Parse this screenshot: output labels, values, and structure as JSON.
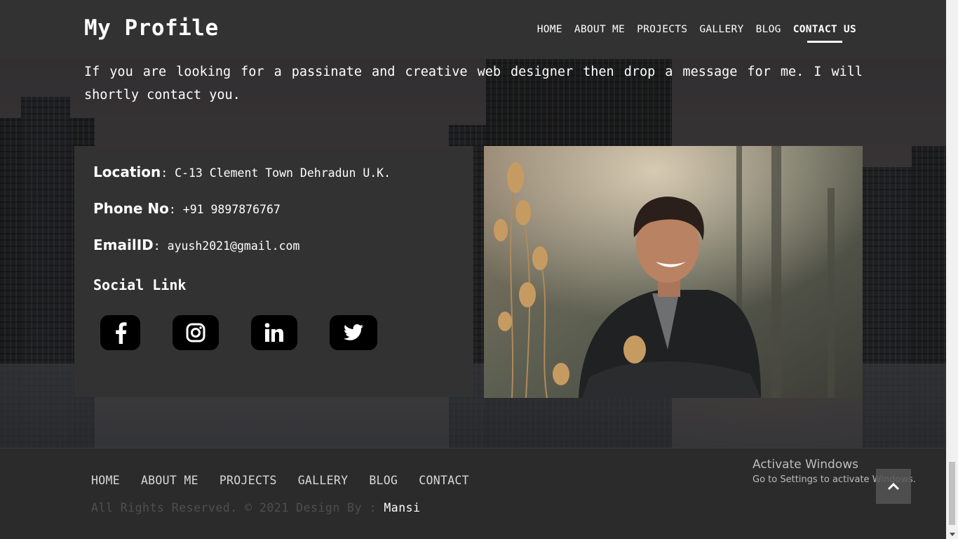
{
  "header": {
    "brand": "My Profile",
    "nav": [
      "HOME",
      "ABOUT ME",
      "PROJECTS",
      "GALLERY",
      "BLOG",
      "CONTACT US"
    ],
    "active_nav": "CONTACT US"
  },
  "intro": "If you are looking for a passinate and creative web designer then drop a message for me. I will shortly contact you.",
  "contact": {
    "location_label": "Location",
    "location_value": ": C-13 Clement Town Dehradun U.K.",
    "phone_label": "Phone No",
    "phone_value": ": +91 9897876767",
    "email_label": "EmailID",
    "email_value": ": ayush2021@gmail.com",
    "social_title": "Social Link",
    "social_icons": [
      "facebook-icon",
      "instagram-icon",
      "linkedin-icon",
      "twitter-icon"
    ]
  },
  "footer": {
    "nav": [
      "HOME",
      "ABOUT ME",
      "PROJECTS",
      "GALLERY",
      "BLOG",
      "CONTACT"
    ],
    "copyright": "All Rights Reserved. © 2021 Design By : ",
    "author": "Mansi"
  },
  "watermark": {
    "line1": "Activate Windows",
    "line2": "Go to Settings to activate Windows."
  },
  "colors": {
    "header_bg": "#333233",
    "panel_bg": "#333233",
    "footer_bg": "#2b2b2b",
    "icon_bg": "#000000",
    "copyright_text": "#4f4f4f"
  }
}
